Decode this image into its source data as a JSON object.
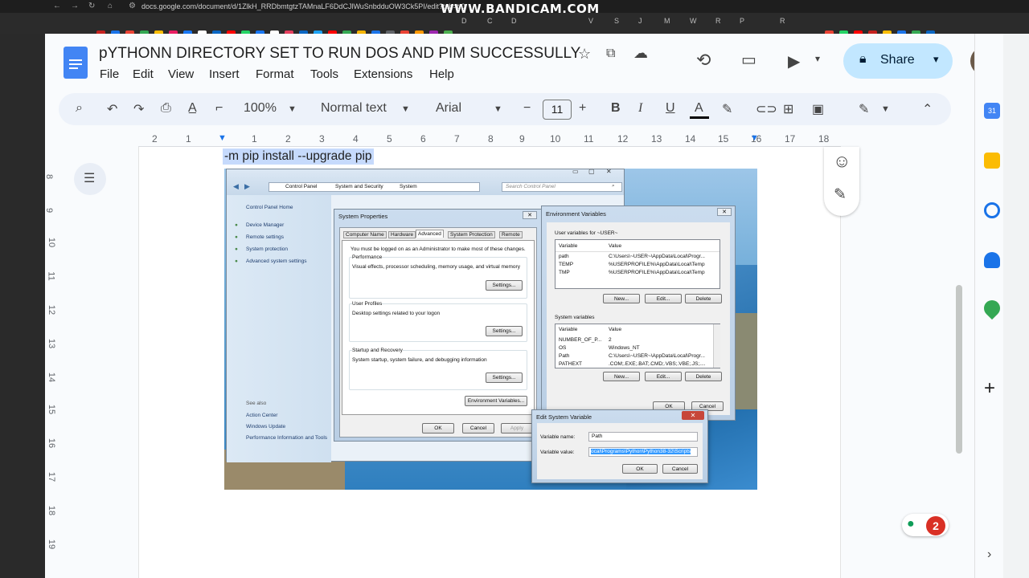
{
  "browser": {
    "url": "docs.google.com/document/d/1ZlkH_RRDbmtgtzTAMnaLF6DdCJlWuSnbdduOW3Ck5PI/edit?tab=t.0",
    "watermark": "WWW.BANDICAM.COM",
    "bookmark_letters": [
      "D",
      "C",
      "D",
      "V",
      "S",
      "J",
      "M",
      "W",
      "R",
      "P",
      "R"
    ]
  },
  "doc": {
    "title": "pYTHONN DIRECTORY SET TO RUN DOS AND PIM SUCCESSULLY",
    "menus": [
      "File",
      "Edit",
      "View",
      "Insert",
      "Format",
      "Tools",
      "Extensions",
      "Help"
    ],
    "share_label": "Share"
  },
  "toolbar": {
    "zoom": "100%",
    "style": "Normal text",
    "font": "Arial",
    "font_size": "11",
    "bold": "B",
    "italic": "I",
    "underline": "U",
    "text_color": "A"
  },
  "ruler": {
    "numbers": [
      "2",
      "1",
      "1",
      "2",
      "3",
      "4",
      "5",
      "6",
      "7",
      "8",
      "9",
      "10",
      "11",
      "12",
      "13",
      "14",
      "15",
      "16",
      "17",
      "18"
    ],
    "vertical_numbers": [
      "8",
      "9",
      "10",
      "11",
      "12",
      "13",
      "14",
      "15",
      "16",
      "17",
      "18",
      "19"
    ]
  },
  "content": {
    "code_line": "-m pip install --upgrade pip"
  },
  "win7": {
    "breadcrumb": [
      "Control Panel",
      "System and Security",
      "System"
    ],
    "search_placeholder": "Search Control Panel",
    "cp_home": "Control Panel Home",
    "cp_links": [
      "Device Manager",
      "Remote settings",
      "System protection",
      "Advanced system settings"
    ],
    "see_also": "See also",
    "see_also_links": [
      "Action Center",
      "Windows Update",
      "Performance Information and Tools"
    ],
    "sysprops": {
      "title": "System Properties",
      "tabs": [
        "Computer Name",
        "Hardware",
        "Advanced",
        "System Protection",
        "Remote"
      ],
      "admin_note": "You must be logged on as an Administrator to make most of these changes.",
      "perf_title": "Performance",
      "perf_desc": "Visual effects, processor scheduling, memory usage, and virtual memory",
      "profiles_title": "User Profiles",
      "profiles_desc": "Desktop settings related to your logon",
      "startup_title": "Startup and Recovery",
      "startup_desc": "System startup, system failure, and debugging information",
      "settings": "Settings...",
      "env_button": "Environment Variables...",
      "ok": "OK",
      "cancel": "Cancel",
      "apply": "Apply"
    },
    "envvars": {
      "title": "Environment Variables",
      "user_label": "User variables for ~USER~",
      "col_variable": "Variable",
      "col_value": "Value",
      "user_rows": [
        {
          "variable": "path",
          "value": "C:\\Users\\~USER~\\AppData\\Local\\Progr..."
        },
        {
          "variable": "TEMP",
          "value": "%USERPROFILE%\\AppData\\Local\\Temp"
        },
        {
          "variable": "TMP",
          "value": "%USERPROFILE%\\AppData\\Local\\Temp"
        }
      ],
      "system_label": "System variables",
      "system_rows": [
        {
          "variable": "NUMBER_OF_P...",
          "value": "2"
        },
        {
          "variable": "OS",
          "value": "Windows_NT"
        },
        {
          "variable": "Path",
          "value": "C:\\Users\\~USER~\\AppData\\Local\\Progr..."
        },
        {
          "variable": "PATHEXT",
          "value": ".COM;.EXE;.BAT;.CMD;.VBS;.VBE;.JS;...."
        }
      ],
      "new": "New...",
      "edit": "Edit...",
      "delete": "Delete",
      "ok": "OK",
      "cancel": "Cancel"
    },
    "editvar": {
      "title": "Edit System Variable",
      "name_label": "Variable name:",
      "name_value": "Path",
      "value_label": "Variable value:",
      "value_value": "ocal\\Programs\\Python\\Python38-32\\Scripts",
      "ok": "OK",
      "cancel": "Cancel"
    }
  },
  "badge": {
    "count": "2"
  },
  "colors": {
    "share_bg": "#c2e7ff",
    "selection": "#c6dafc",
    "docs_blue": "#4285f4",
    "badge_red": "#d93025"
  }
}
